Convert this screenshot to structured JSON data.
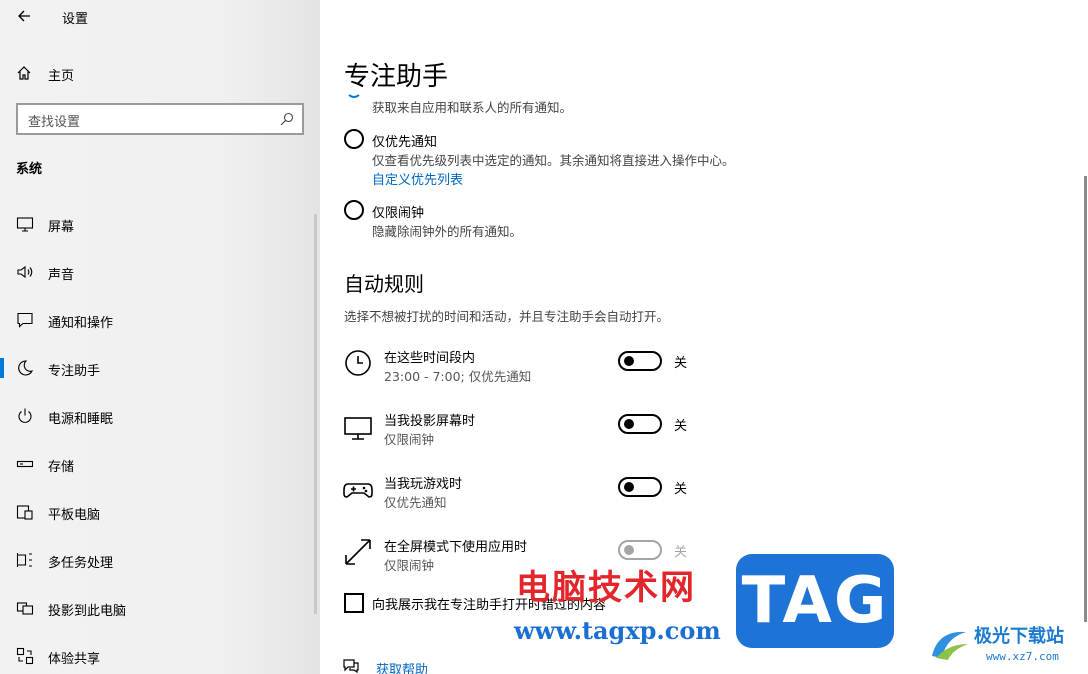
{
  "window": {
    "title": "设置",
    "minimize_icon": "minimize-icon",
    "maximize_icon": "maximize-icon",
    "close_icon": "close-icon"
  },
  "sidebar": {
    "home_label": "主页",
    "search_placeholder": "查找设置",
    "section_title": "系统",
    "items": [
      {
        "label": "屏幕",
        "icon": "monitor-icon"
      },
      {
        "label": "声音",
        "icon": "speaker-icon"
      },
      {
        "label": "通知和操作",
        "icon": "notification-icon"
      },
      {
        "label": "专注助手",
        "icon": "moon-icon",
        "selected": true
      },
      {
        "label": "电源和睡眠",
        "icon": "power-icon"
      },
      {
        "label": "存储",
        "icon": "storage-icon"
      },
      {
        "label": "平板电脑",
        "icon": "tablet-icon"
      },
      {
        "label": "多任务处理",
        "icon": "multitask-icon"
      },
      {
        "label": "投影到此电脑",
        "icon": "project-icon"
      },
      {
        "label": "体验共享",
        "icon": "share-icon"
      }
    ],
    "accent_color": "#0078d7"
  },
  "main": {
    "title": "专注助手",
    "off_option_desc": "获取来自应用和联系人的所有通知。",
    "priority_option": {
      "label": "仅优先通知",
      "desc": "仅查看优先级列表中选定的通知。其余通知将直接进入操作中心。",
      "link": "自定义优先列表"
    },
    "alarms_option": {
      "label": "仅限闹钟",
      "desc": "隐藏除闹钟外的所有通知。"
    },
    "auto_rules": {
      "heading": "自动规则",
      "desc": "选择不想被打扰的时间和活动，并且专注助手会自动打开。",
      "rules": [
        {
          "title": "在这些时间段内",
          "sub": "23:00 - 7:00; 仅优先通知",
          "state": "关",
          "icon": "clock-icon"
        },
        {
          "title": "当我投影屏幕时",
          "sub": "仅限闹钟",
          "state": "关",
          "icon": "display-icon"
        },
        {
          "title": "当我玩游戏时",
          "sub": "仅优先通知",
          "state": "关",
          "icon": "gamepad-icon"
        },
        {
          "title": "在全屏模式下使用应用时",
          "sub": "仅限闹钟",
          "state": "关",
          "icon": "fullscreen-icon"
        }
      ]
    },
    "summary_checkbox": "向我展示我在专注助手打开时错过的内容",
    "help_link": "获取帮助",
    "link_color": "#0067c0"
  },
  "watermark": {
    "cn_text": "电脑技术网",
    "url": "www.tagxp.com",
    "tag": "TAG",
    "logo_text": "极光下载站",
    "logo_url": "www.xz7.com"
  }
}
